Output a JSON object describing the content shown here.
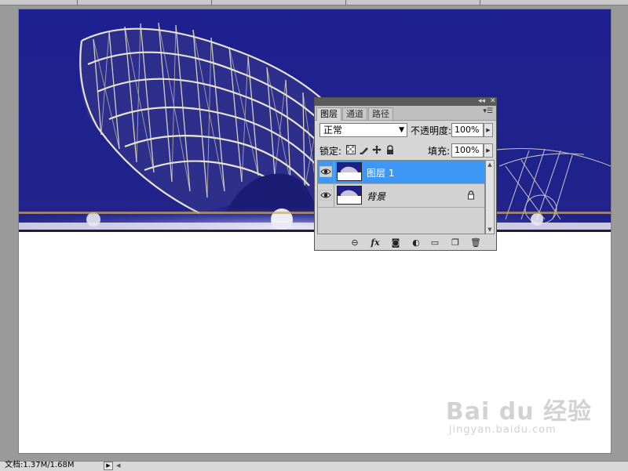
{
  "layers_panel": {
    "tabs": [
      {
        "label": "图层",
        "active": true
      },
      {
        "label": "通道",
        "active": false
      },
      {
        "label": "路径",
        "active": false
      }
    ],
    "blend_mode": "正常",
    "opacity_label": "不透明度:",
    "opacity_value": "100%",
    "lock_label": "锁定:",
    "fill_label": "填充:",
    "fill_value": "100%",
    "layers": [
      {
        "name": "图层 1",
        "selected": true,
        "visible": true,
        "locked": false
      },
      {
        "name": "背景",
        "selected": false,
        "visible": true,
        "locked": true
      }
    ],
    "footer_icons": [
      "link-icon",
      "fx-icon",
      "mask-icon",
      "adjustment-icon",
      "group-folder-icon",
      "new-layer-icon",
      "trash-icon"
    ]
  },
  "status_bar": {
    "doc_info": "文档:1.37M/1.68M"
  },
  "watermark": {
    "brand": "Bai du 经验",
    "sub": "jingyan.baidu.com"
  },
  "colors": {
    "selection": "#3d97f4",
    "sky": "#1c1f7e",
    "panel_bg": "#d6d6d6"
  }
}
